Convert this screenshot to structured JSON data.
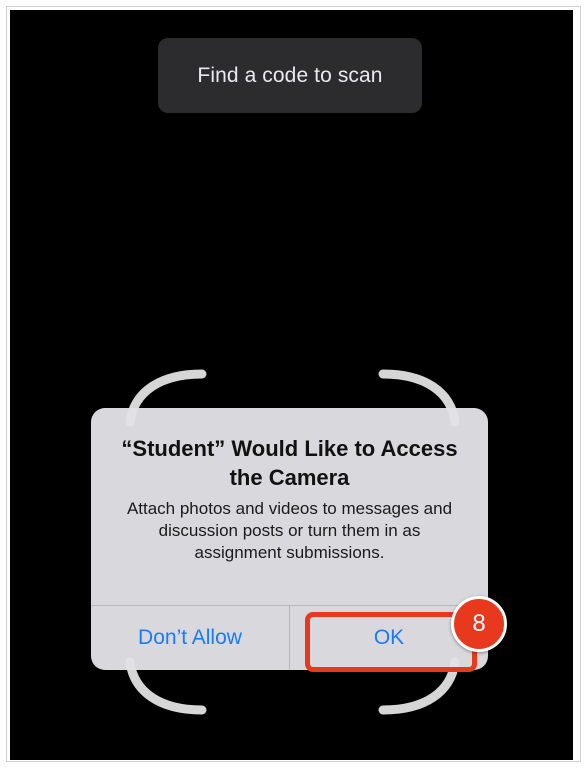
{
  "scanner": {
    "banner_text": "Find a code to scan"
  },
  "permission_alert": {
    "title": "“Student” Would Like to Access the Camera",
    "message": "Attach photos and videos to messages and discussion posts or turn them in as assignment submissions.",
    "deny_label": "Don’t Allow",
    "ok_label": "OK"
  },
  "annotation": {
    "step_number": "8",
    "color": "#e8391f"
  },
  "colors": {
    "background": "#000000",
    "button_text": "#1a7cf5"
  }
}
